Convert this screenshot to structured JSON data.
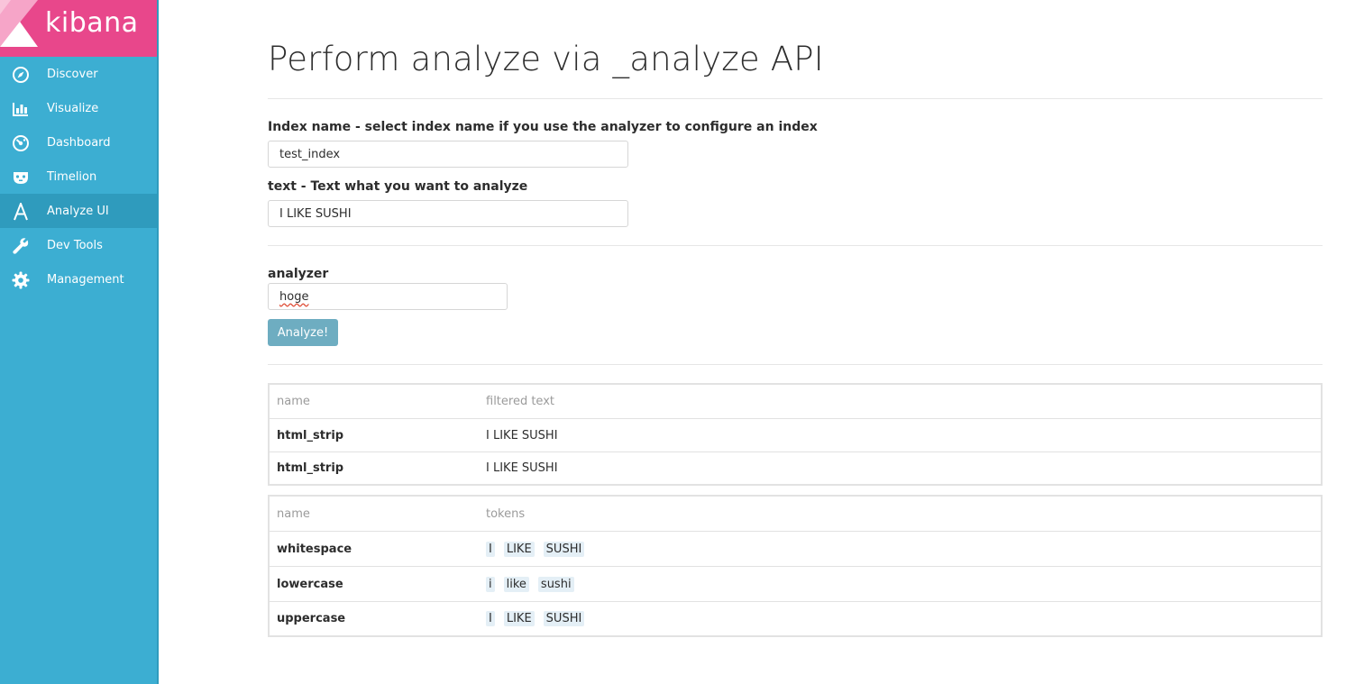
{
  "app": {
    "logo_text": "kibana",
    "brand_color": "#e8478b",
    "sidebar_color": "#3caed2"
  },
  "sidebar": {
    "items": [
      {
        "label": "Discover",
        "icon": "compass-icon"
      },
      {
        "label": "Visualize",
        "icon": "bar-chart-icon"
      },
      {
        "label": "Dashboard",
        "icon": "dashboard-gauge-icon"
      },
      {
        "label": "Timelion",
        "icon": "timelion-mask-icon"
      },
      {
        "label": "Analyze UI",
        "icon": "letter-a-icon",
        "active": true
      },
      {
        "label": "Dev Tools",
        "icon": "wrench-icon"
      },
      {
        "label": "Management",
        "icon": "gear-icon"
      }
    ]
  },
  "main": {
    "title": "Perform analyze via _analyze API",
    "index_label": "Index name - select index name if you use the analyzer to configure an index",
    "index_value": "test_index",
    "text_label": "text - Text what you want to analyze",
    "text_value": "I LIKE SUSHI",
    "analyzer_label": "analyzer",
    "analyzer_value": "hoge",
    "analyze_button": "Analyze!"
  },
  "filters_table": {
    "headers": [
      "name",
      "filtered text"
    ],
    "rows": [
      {
        "name": "html_strip",
        "text": "I LIKE SUSHI"
      },
      {
        "name": "html_strip",
        "text": "I LIKE SUSHI"
      }
    ]
  },
  "tokens_table": {
    "headers": [
      "name",
      "tokens"
    ],
    "rows": [
      {
        "name": "whitespace",
        "tokens": [
          "I",
          "LIKE",
          "SUSHI"
        ]
      },
      {
        "name": "lowercase",
        "tokens": [
          "i",
          "like",
          "sushi"
        ]
      },
      {
        "name": "uppercase",
        "tokens": [
          "I",
          "LIKE",
          "SUSHI"
        ]
      }
    ]
  }
}
